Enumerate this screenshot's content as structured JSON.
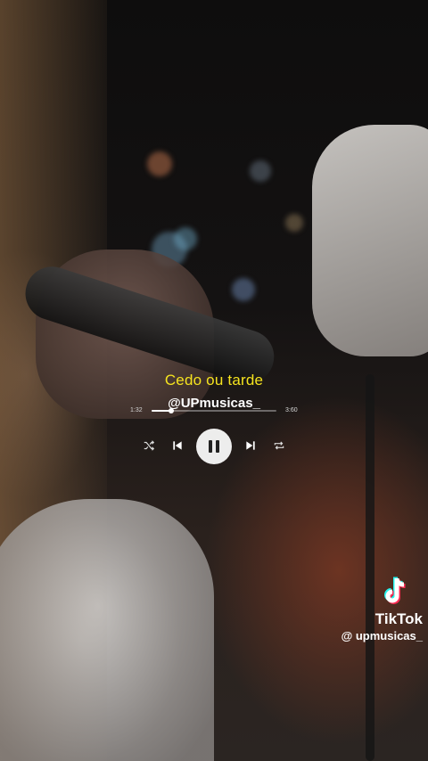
{
  "player": {
    "song_title": "Cedo ou tarde",
    "channel_handle": "@UPmusicas_",
    "elapsed_time": "1:32",
    "total_time": "3:60",
    "progress_fraction": 0.16,
    "controls": {
      "shuffle_icon": "shuffle-icon",
      "previous_icon": "skip-previous-icon",
      "pause_icon": "pause-icon",
      "next_icon": "skip-next-icon",
      "repeat_icon": "repeat-icon"
    }
  },
  "watermark": {
    "brand": "TikTok",
    "user": "@ upmusicas_",
    "logo_icon": "tiktok-logo-icon"
  },
  "colors": {
    "title": "#f5e31f",
    "text": "#ffffff",
    "accent_cyan": "#25f4ee",
    "accent_red": "#fe2c55"
  }
}
